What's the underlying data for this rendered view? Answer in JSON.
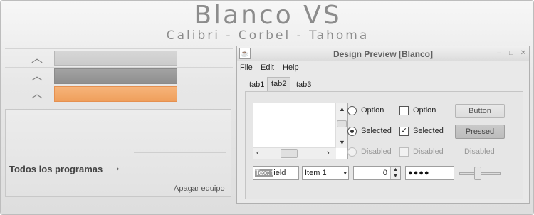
{
  "header": {
    "title": "Blanco VS",
    "subtitle": "Calibri - Corbel - Tahoma"
  },
  "start_menu": {
    "strips": [
      {
        "state": "normal",
        "icon": "chevron-up-icon"
      },
      {
        "state": "hover",
        "icon": "chevron-up-icon"
      },
      {
        "state": "selected",
        "icon": "chevron-up-icon"
      }
    ],
    "all_programs_label": "Todos los programas",
    "all_programs_icon": "chevron-right-icon",
    "shutdown_label": "Apagar equipo"
  },
  "preview_window": {
    "title": "Design Preview [Blanco]",
    "app_icon": "java-cup-icon",
    "menu": [
      "File",
      "Edit",
      "Help"
    ],
    "tabs": [
      "tab1",
      "tab2",
      "tab3"
    ],
    "active_tab": "tab2",
    "radios": {
      "option_label": "Option",
      "selected_label": "Selected",
      "disabled_label": "Disabled"
    },
    "checkboxes": {
      "option_label": "Option",
      "selected_label": "Selected",
      "disabled_label": "Disabled"
    },
    "buttons": {
      "button_label": "Button",
      "pressed_label": "Pressed",
      "disabled_label": "Disabled"
    },
    "text_field": {
      "selected_part": "Text f",
      "rest": "ield"
    },
    "combo_value": "Item 1",
    "spinner_value": "0",
    "password_mask": "●●●●",
    "slider_value_fraction": 0.5
  },
  "colors": {
    "accent_orange": "#ef9f5c",
    "hover_gray": "#929292",
    "text_gray": "#8c8c8c"
  }
}
